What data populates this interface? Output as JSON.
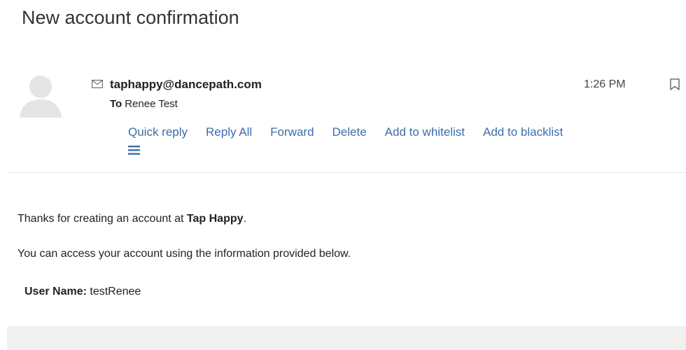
{
  "message": {
    "subject": "New account confirmation",
    "sender": "taphappy@dancepath.com",
    "to_label": "To",
    "to_name": "Renee Test",
    "time": "1:26 PM"
  },
  "actions": {
    "quick_reply": "Quick reply",
    "reply_all": "Reply All",
    "forward": "Forward",
    "delete": "Delete",
    "add_whitelist": "Add to whitelist",
    "add_blacklist": "Add to blacklist"
  },
  "icons": {
    "avatar": "user-avatar-icon",
    "envelope": "envelope-icon",
    "bookmark": "bookmark-icon",
    "menu": "menu-icon"
  },
  "colors": {
    "link": "#3d6ea7",
    "footer": "#f0f0f0",
    "avatar": "#e5e5e5"
  },
  "body": {
    "line1_prefix": "Thanks for creating an account at ",
    "line1_bold": "Tap Happy",
    "line1_suffix": ".",
    "line2": "You can access your account using the information provided below.",
    "user_label": "User Name:",
    "user_value": "testRenee"
  }
}
